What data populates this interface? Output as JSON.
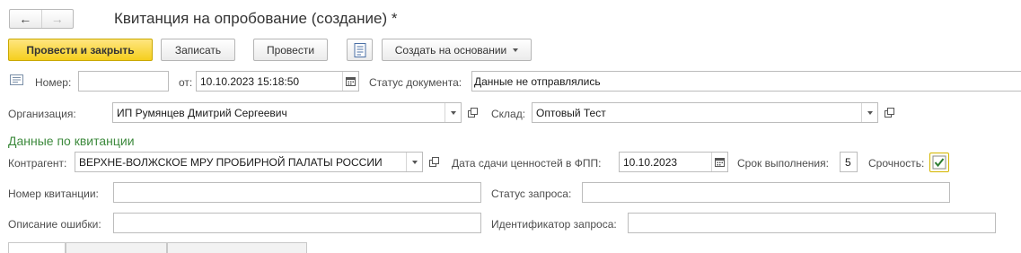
{
  "nav": {
    "back_label": "←",
    "forward_label": "→"
  },
  "window": {
    "title": "Квитанция на опробование (создание) *"
  },
  "toolbar": {
    "post_close_label": "Провести и закрыть",
    "save_label": "Записать",
    "post_label": "Провести",
    "create_based_label": "Создать на основании"
  },
  "header": {
    "number_label": "Номер:",
    "number_value": "",
    "date_label": "от:",
    "date_value": "10.10.2023 15:18:50",
    "status_label": "Статус документа:",
    "status_value": "Данные не отправлялись",
    "org_label": "Организация:",
    "org_value": "ИП Румянцев Дмитрий Сергеевич",
    "warehouse_label": "Склад:",
    "warehouse_value": "Оптовый Тест"
  },
  "receipt": {
    "section_title": "Данные по квитанции",
    "counterparty_label": "Контрагент:",
    "counterparty_value": "ВЕРХНЕ-ВОЛЖСКОЕ МРУ ПРОБИРНОЙ ПАЛАТЫ РОССИИ",
    "delivery_date_label": "Дата сдачи ценностей в ФПП:",
    "delivery_date_value": "10.10.2023",
    "term_label": "Срок выполнения:",
    "term_value": "5",
    "urgency_label": "Срочность:",
    "urgency_checked": true,
    "receipt_number_label": "Номер квитанции:",
    "receipt_number_value": "",
    "request_status_label": "Статус запроса:",
    "request_status_value": "",
    "error_label": "Описание ошибки:",
    "error_value": "",
    "request_id_label": "Идентификатор запроса:",
    "request_id_value": ""
  },
  "colors": {
    "primary_button": "#f5cf1e",
    "section_title": "#3d8a3d",
    "checkbox_border": "#d4b600",
    "checkmark": "#2e7d32"
  },
  "icons": {
    "document_icon": "document-list-icon",
    "calendar_icon": "calendar-icon",
    "open_icon": "open-form-icon",
    "dropdown_icon": "chevron-down-icon",
    "checkbox_icon": "checkbox-checked-icon"
  }
}
